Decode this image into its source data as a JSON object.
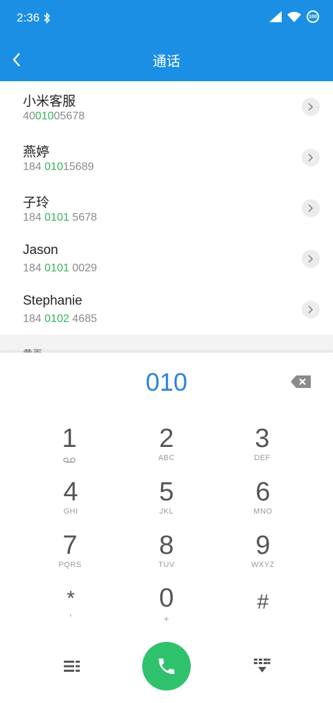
{
  "status": {
    "time": "2:36",
    "battery": "100"
  },
  "header": {
    "title": "通话"
  },
  "contacts": [
    {
      "name": "小米客服",
      "number_pre": "40",
      "number_hl": "010",
      "number_post": "05678"
    },
    {
      "name": "燕婷",
      "number_pre": "184 ",
      "number_hl": "010",
      "number_post": "15689"
    },
    {
      "name": "子玲",
      "number_pre": "184 ",
      "number_hl": "0101",
      "number_post": " 5678"
    },
    {
      "name": "Jason",
      "number_pre": "184 ",
      "number_hl": "0101",
      "number_post": " 0029"
    },
    {
      "name": "Stephanie",
      "number_pre": "184 ",
      "number_hl": "0102",
      "number_post": " 4685"
    }
  ],
  "section": {
    "label": "黄页"
  },
  "dialer": {
    "input": "010"
  },
  "keys": [
    {
      "digit": "1",
      "letters": ""
    },
    {
      "digit": "2",
      "letters": "ABC"
    },
    {
      "digit": "3",
      "letters": "DEF"
    },
    {
      "digit": "4",
      "letters": "GHI"
    },
    {
      "digit": "5",
      "letters": "JKL"
    },
    {
      "digit": "6",
      "letters": "MNO"
    },
    {
      "digit": "7",
      "letters": "PQRS"
    },
    {
      "digit": "8",
      "letters": "TUV"
    },
    {
      "digit": "9",
      "letters": "WXYZ"
    },
    {
      "digit": "*",
      "letters": ","
    },
    {
      "digit": "0",
      "letters": "+"
    },
    {
      "digit": "#",
      "letters": ""
    }
  ],
  "colors": {
    "primary": "#1a8fe3",
    "match": "#35b45a",
    "call": "#2ec26c",
    "dial_text": "#2a83e0"
  }
}
